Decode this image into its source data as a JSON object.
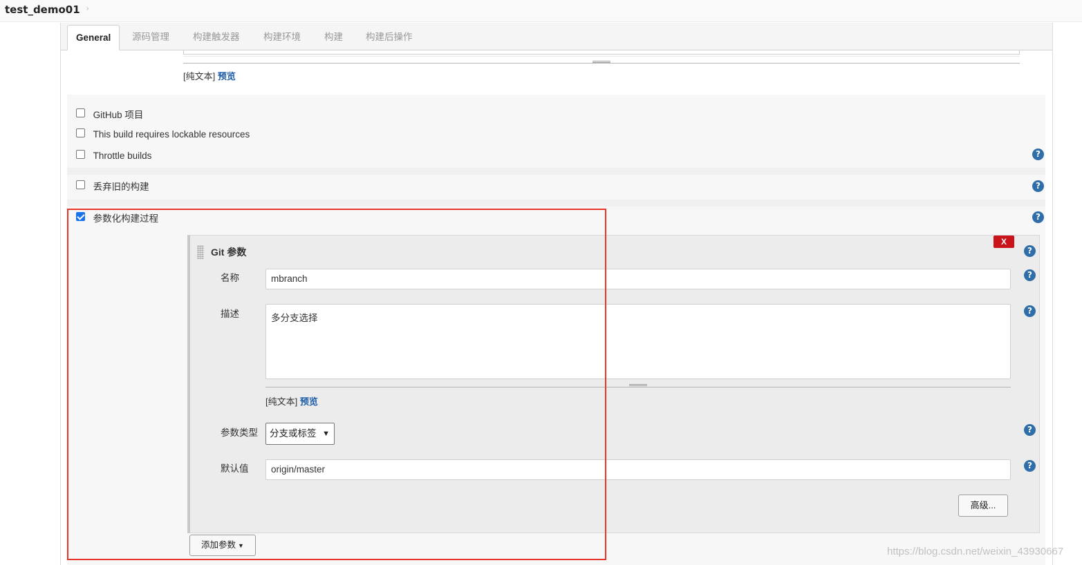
{
  "header": {
    "project_name": "test_demo01",
    "breadcrumb_separator": "›"
  },
  "tabs": [
    {
      "label": "General",
      "active": true
    },
    {
      "label": "源码管理",
      "active": false
    },
    {
      "label": "构建触发器",
      "active": false
    },
    {
      "label": "构建环境",
      "active": false
    },
    {
      "label": "构建",
      "active": false
    },
    {
      "label": "构建后操作",
      "active": false
    }
  ],
  "description_format": {
    "plain_text": "[纯文本]",
    "preview": "预览"
  },
  "options": [
    {
      "label": "GitHub 项目",
      "checked": false
    },
    {
      "label": "This build requires lockable resources",
      "checked": false
    },
    {
      "label": "Throttle builds",
      "checked": false
    },
    {
      "label": "丢弃旧的构建",
      "checked": false
    },
    {
      "label": "参数化构建过程",
      "checked": true
    }
  ],
  "help_icon_glyph": "?",
  "git_parameter": {
    "title": "Git 参数",
    "delete_label": "X",
    "name_label": "名称",
    "name_value": "mbranch",
    "description_label": "描述",
    "description_value": "多分支选择",
    "format_plain_text": "[纯文本]",
    "format_preview": "预览",
    "type_label": "参数类型",
    "type_value": "分支或标签",
    "default_label": "默认值",
    "default_value": "origin/master",
    "advanced_label": "高级..."
  },
  "add_parameter_label": "添加参数",
  "watermark": "https://blog.csdn.net/weixin_43930667",
  "colors": {
    "link": "#1f5ea8",
    "help_icon": "#2f6ea9",
    "delete_button": "#c9141c",
    "highlight_box": "#e8352a",
    "checkbox_checked": "#1a73e8"
  }
}
